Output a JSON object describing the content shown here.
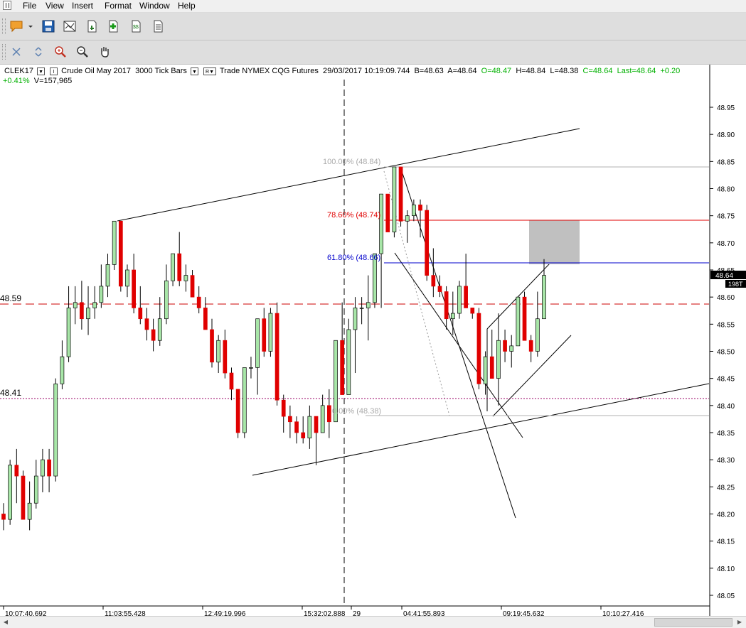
{
  "menu": [
    "File",
    "View",
    "Insert",
    "Format",
    "Window",
    "Help"
  ],
  "toolbar1": {
    "icons": [
      "sticky-note-icon",
      "dropdown-arrow-icon",
      "save-icon",
      "chart-properties-icon",
      "export-icon",
      "add-indicator-icon",
      "data-window-icon",
      "document-icon"
    ]
  },
  "toolbar2": {
    "icons": [
      "crosshair-icon",
      "cursor-icon",
      "zoom-in-icon",
      "zoom-out-icon",
      "hand-icon"
    ]
  },
  "header": {
    "symbol": "CLEK17",
    "instrument": "Crude Oil May 2017",
    "bar_type": "3000 Tick Bars",
    "feed": "Trade  NYMEX  CQG  Futures",
    "datetime": "29/03/2017  10:19:09.744",
    "bid": "B=48.63",
    "ask": "A=48.64",
    "open": "O=48.47",
    "high": "H=48.84",
    "low": "L=48.38",
    "close": "C=48.64",
    "last": "Last=48.64",
    "change": "+0.20",
    "change_pct": "+0.41%",
    "volume": "V=157,965"
  },
  "chart_data": {
    "type": "candlestick",
    "y_ticks": [
      "48.95",
      "48.90",
      "48.85",
      "48.80",
      "48.75",
      "48.70",
      "48.65",
      "48.60",
      "48.55",
      "48.50",
      "48.45",
      "48.40",
      "48.35",
      "48.30",
      "48.25",
      "48.20",
      "48.15",
      "48.10",
      "48.05"
    ],
    "ylim": [
      48.03,
      48.98
    ],
    "x_labels": [
      "10:07:40.692",
      "11:03:55.428",
      "12:49:19.996",
      "15:32:02.888",
      "29",
      "04:41:55.893",
      "09:19:45.632",
      "10:10:27.416"
    ],
    "last_price_label": "48.64",
    "partial_label": "198T",
    "hline_labels": {
      "red": "48.59",
      "purple": "48.41"
    },
    "fib_labels": {
      "f100": "100.00% (48.84)",
      "f786": "78.60% (48.74)",
      "f618": "61.80% (48.66)",
      "f0": "0.00% (48.38)"
    },
    "colors": {
      "up": "#a8e6a8",
      "down": "#e00000",
      "fib_red": "#e00000",
      "fib_blue": "#0000cc",
      "fib_gray": "#b0b0b0",
      "dash_red": "#cc0000",
      "dotted_purple": "#990066",
      "box": "#c0c0c0"
    },
    "candles": [
      [
        48.2,
        48.22,
        48.17,
        48.19
      ],
      [
        48.19,
        48.3,
        48.18,
        48.29
      ],
      [
        48.29,
        48.32,
        48.22,
        48.27
      ],
      [
        48.27,
        48.28,
        48.19,
        48.19
      ],
      [
        48.19,
        48.26,
        48.17,
        48.22
      ],
      [
        48.22,
        48.3,
        48.21,
        48.27
      ],
      [
        48.27,
        48.32,
        48.24,
        48.3
      ],
      [
        48.3,
        48.32,
        48.24,
        48.27
      ],
      [
        48.27,
        48.45,
        48.26,
        48.44
      ],
      [
        48.44,
        48.52,
        48.43,
        48.49
      ],
      [
        48.49,
        48.62,
        48.48,
        48.58
      ],
      [
        48.58,
        48.62,
        48.55,
        48.59
      ],
      [
        48.59,
        48.63,
        48.54,
        48.56
      ],
      [
        48.56,
        48.62,
        48.53,
        48.58
      ],
      [
        48.58,
        48.62,
        48.56,
        48.59
      ],
      [
        48.59,
        48.66,
        48.58,
        48.62
      ],
      [
        48.62,
        48.68,
        48.6,
        48.66
      ],
      [
        48.66,
        48.74,
        48.65,
        48.74
      ],
      [
        48.74,
        48.74,
        48.61,
        48.62
      ],
      [
        48.62,
        48.66,
        48.6,
        48.65
      ],
      [
        48.65,
        48.68,
        48.57,
        48.58
      ],
      [
        48.58,
        48.62,
        48.55,
        48.56
      ],
      [
        48.56,
        48.58,
        48.52,
        48.54
      ],
      [
        48.54,
        48.56,
        48.5,
        48.52
      ],
      [
        48.52,
        48.6,
        48.51,
        48.56
      ],
      [
        48.56,
        48.66,
        48.55,
        48.63
      ],
      [
        48.63,
        48.68,
        48.62,
        48.68
      ],
      [
        48.68,
        48.72,
        48.62,
        48.63
      ],
      [
        48.63,
        48.66,
        48.61,
        48.64
      ],
      [
        48.64,
        48.65,
        48.6,
        48.6
      ],
      [
        48.6,
        48.62,
        48.57,
        48.58
      ],
      [
        48.58,
        48.6,
        48.54,
        48.54
      ],
      [
        48.54,
        48.56,
        48.47,
        48.48
      ],
      [
        48.48,
        48.53,
        48.46,
        48.52
      ],
      [
        48.52,
        48.54,
        48.45,
        48.46
      ],
      [
        48.46,
        48.47,
        48.41,
        48.43
      ],
      [
        48.43,
        48.43,
        48.34,
        48.35
      ],
      [
        48.35,
        48.47,
        48.34,
        48.47
      ],
      [
        48.47,
        48.49,
        48.45,
        48.47
      ],
      [
        48.47,
        48.56,
        48.42,
        48.56
      ],
      [
        48.56,
        48.58,
        48.49,
        48.5
      ],
      [
        48.5,
        48.58,
        48.49,
        48.57
      ],
      [
        48.57,
        48.59,
        48.4,
        48.41
      ],
      [
        48.41,
        48.42,
        48.35,
        48.38
      ],
      [
        48.38,
        48.4,
        48.34,
        48.37
      ],
      [
        48.37,
        48.38,
        48.33,
        48.35
      ],
      [
        48.35,
        48.38,
        48.33,
        48.34
      ],
      [
        48.34,
        48.4,
        48.32,
        48.38
      ],
      [
        48.38,
        48.38,
        48.29,
        48.35
      ],
      [
        48.35,
        48.42,
        48.35,
        48.4
      ],
      [
        48.4,
        48.43,
        48.34,
        48.37
      ],
      [
        48.37,
        48.52,
        48.37,
        48.52
      ],
      [
        48.52,
        48.59,
        48.42,
        48.42
      ],
      [
        48.42,
        48.56,
        48.43,
        48.54
      ],
      [
        48.54,
        48.6,
        48.46,
        48.58
      ],
      [
        48.58,
        48.6,
        48.55,
        48.58
      ],
      [
        48.58,
        48.64,
        48.52,
        48.59
      ],
      [
        48.59,
        48.67,
        48.58,
        48.68
      ],
      [
        48.68,
        48.74,
        48.58,
        48.79
      ],
      [
        48.79,
        48.79,
        48.74,
        48.72
      ],
      [
        48.72,
        48.84,
        48.71,
        48.84
      ],
      [
        48.84,
        48.84,
        48.73,
        48.74
      ],
      [
        48.74,
        48.76,
        48.7,
        48.75
      ],
      [
        48.75,
        48.78,
        48.74,
        48.77
      ],
      [
        48.77,
        48.78,
        48.71,
        48.76
      ],
      [
        48.76,
        48.77,
        48.63,
        48.64
      ],
      [
        48.64,
        48.69,
        48.6,
        48.62
      ],
      [
        48.62,
        48.64,
        48.6,
        48.61
      ],
      [
        48.61,
        48.62,
        48.54,
        48.56
      ],
      [
        48.56,
        48.61,
        48.53,
        48.57
      ],
      [
        48.57,
        48.63,
        48.56,
        48.62
      ],
      [
        48.62,
        48.68,
        48.58,
        48.58
      ],
      [
        48.58,
        48.58,
        48.56,
        48.57
      ],
      [
        48.57,
        48.58,
        48.43,
        48.44
      ],
      [
        48.44,
        48.5,
        48.42,
        48.49
      ],
      [
        48.49,
        48.54,
        48.45,
        48.45
      ],
      [
        48.45,
        48.57,
        48.4,
        48.52
      ],
      [
        48.52,
        48.54,
        48.48,
        48.5
      ],
      [
        48.5,
        48.53,
        48.47,
        48.51
      ],
      [
        48.51,
        48.6,
        48.51,
        48.6
      ],
      [
        48.6,
        48.61,
        48.53,
        48.52
      ],
      [
        48.52,
        48.53,
        48.48,
        48.5
      ],
      [
        48.5,
        48.61,
        48.49,
        48.56
      ],
      [
        48.56,
        48.67,
        48.58,
        48.64
      ]
    ]
  }
}
